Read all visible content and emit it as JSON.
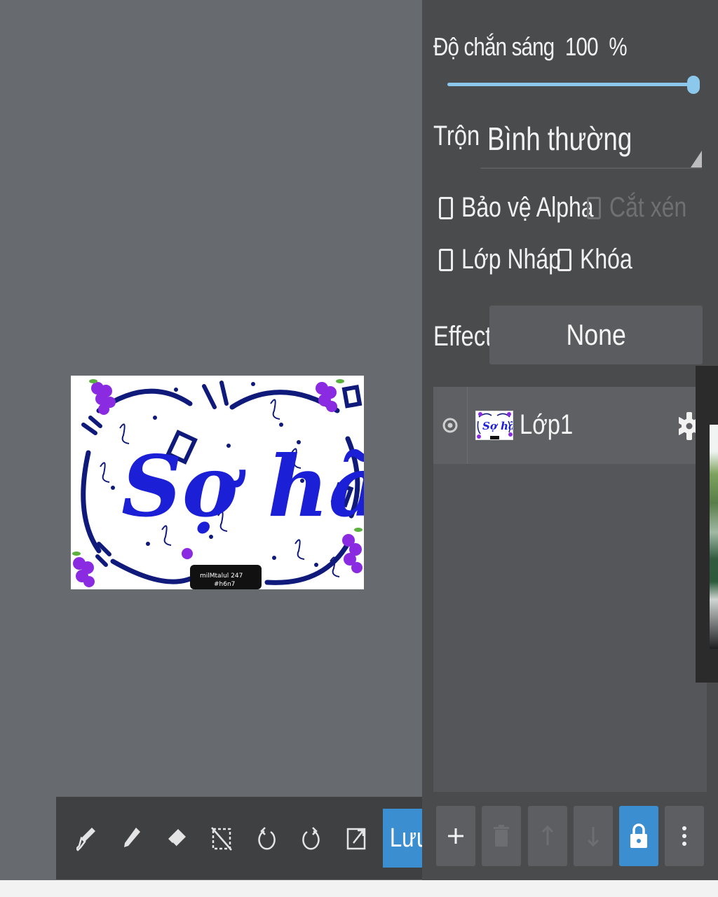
{
  "layer_panel": {
    "opacity_label": "Độ chắn sáng",
    "opacity_value": "100",
    "opacity_unit": "%",
    "opacity_level": 1.0,
    "blend_label": "Trộn",
    "blend_value": "Bình thường",
    "checkboxes": {
      "protect_alpha": "Bảo vệ Alpha",
      "clipping": "Cắt xén",
      "draft_layer": "Lớp Nháp",
      "lock": "Khóa"
    },
    "effect_label": "Effect",
    "effect_value": "None",
    "layers": [
      {
        "name": "Lớp1",
        "visible": true
      }
    ]
  },
  "artwork": {
    "title_text": "Sợ hãi",
    "watermark_line1": "milMtalul 247",
    "watermark_line2": "#h6n7"
  },
  "toolbar": {
    "tools": [
      "eyedropper-icon",
      "pen-icon",
      "eraser-icon",
      "deselect-icon",
      "undo-icon",
      "redo-icon",
      "export-icon"
    ],
    "save_label": "Lưu"
  },
  "layer_actions": [
    "add-layer-icon",
    "delete-layer-icon",
    "move-up-icon",
    "move-down-icon",
    "lock-icon",
    "more-icon"
  ],
  "colors": {
    "accent": "#3b8fd0",
    "slider": "#8cc8ec",
    "panel_bg": "#4a4b4d",
    "canvas_bg": "#676a6f",
    "art_blue": "#1b1fd6",
    "art_navy": "#0f1a7a",
    "art_purple": "#8a2be2"
  }
}
